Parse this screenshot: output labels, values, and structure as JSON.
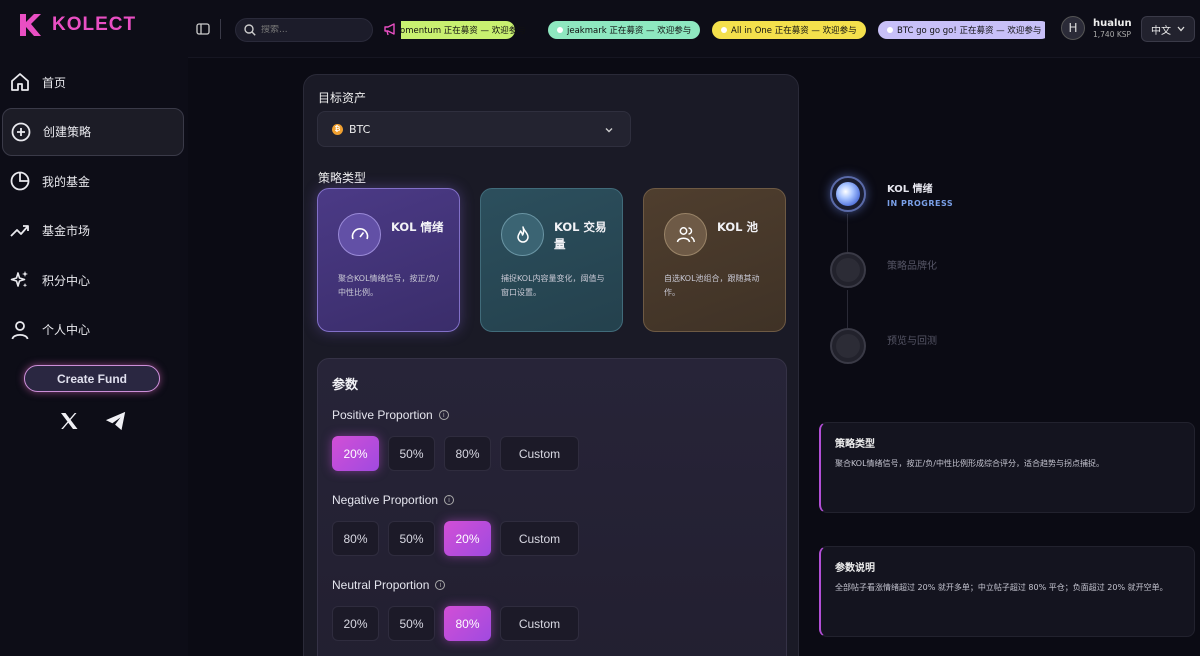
{
  "brand": {
    "name": "KOLECT",
    "color": "#e94fc3"
  },
  "sidebar": {
    "items": [
      {
        "label": "首页",
        "icon": "home-icon"
      },
      {
        "label": "创建策略",
        "icon": "plus-circle-icon",
        "active": true
      },
      {
        "label": "我的基金",
        "icon": "pie-chart-icon"
      },
      {
        "label": "基金市场",
        "icon": "trending-up-icon"
      },
      {
        "label": "积分中心",
        "icon": "sparkles-icon"
      },
      {
        "label": "个人中心",
        "icon": "user-icon"
      }
    ],
    "create_button": "Create Fund",
    "social": [
      "x-icon",
      "telegram-icon"
    ]
  },
  "topbar": {
    "search_placeholder": "搜索...",
    "ticker": [
      {
        "text": "omentum 正在募资 — 欢迎参与",
        "color": "#c8f070"
      },
      {
        "text": "jeakmark 正在募资 — 欢迎参与",
        "color": "#8ee8c0"
      },
      {
        "text": "All in One 正在募资 — 欢迎参与",
        "color": "#f4e04c"
      },
      {
        "text": "BTC go go go! 正在募资 — 欢迎参与",
        "color": "#c8c0f8"
      }
    ],
    "user": {
      "initial": "H",
      "name": "hualun",
      "balance": "1,740 KSP"
    },
    "language": "中文"
  },
  "form": {
    "asset_label": "目标资产",
    "asset_value": "BTC",
    "asset_coin_glyph": "₿",
    "strategy_label": "策略类型",
    "strategy_cards": [
      {
        "title": "KOL 情绪",
        "desc": "聚合KOL情绪信号，按正/负/中性比例。",
        "selected": true
      },
      {
        "title": "KOL 交易量",
        "desc": "捕捉KOL内容量变化，阈值与窗口设置。",
        "selected": false
      },
      {
        "title": "KOL 池",
        "desc": "自选KOL池组合，跟随其动作。",
        "selected": false
      }
    ],
    "params_title": "参数",
    "params": [
      {
        "label": "Positive Proportion",
        "options": [
          "20%",
          "50%",
          "80%",
          "Custom"
        ],
        "selected": "20%"
      },
      {
        "label": "Negative Proportion",
        "options": [
          "80%",
          "50%",
          "20%",
          "Custom"
        ],
        "selected": "20%"
      },
      {
        "label": "Neutral Proportion",
        "options": [
          "20%",
          "50%",
          "80%",
          "Custom"
        ],
        "selected": "80%"
      }
    ]
  },
  "steps": [
    {
      "name": "KOL 情绪",
      "status": "IN PROGRESS",
      "active": true
    },
    {
      "name": "策略品牌化",
      "status": "",
      "active": false
    },
    {
      "name": "预览与回测",
      "status": "",
      "active": false
    }
  ],
  "info": [
    {
      "title": "策略类型",
      "text": "聚合KOL情绪信号，按正/负/中性比例形成综合评分，适合趋势与拐点捕捉。"
    },
    {
      "title": "参数说明",
      "text": "全部帖子看涨情绪超过 20% 就开多单；中立帖子超过 80% 平仓；负面超过 20% 就开空单。"
    }
  ]
}
